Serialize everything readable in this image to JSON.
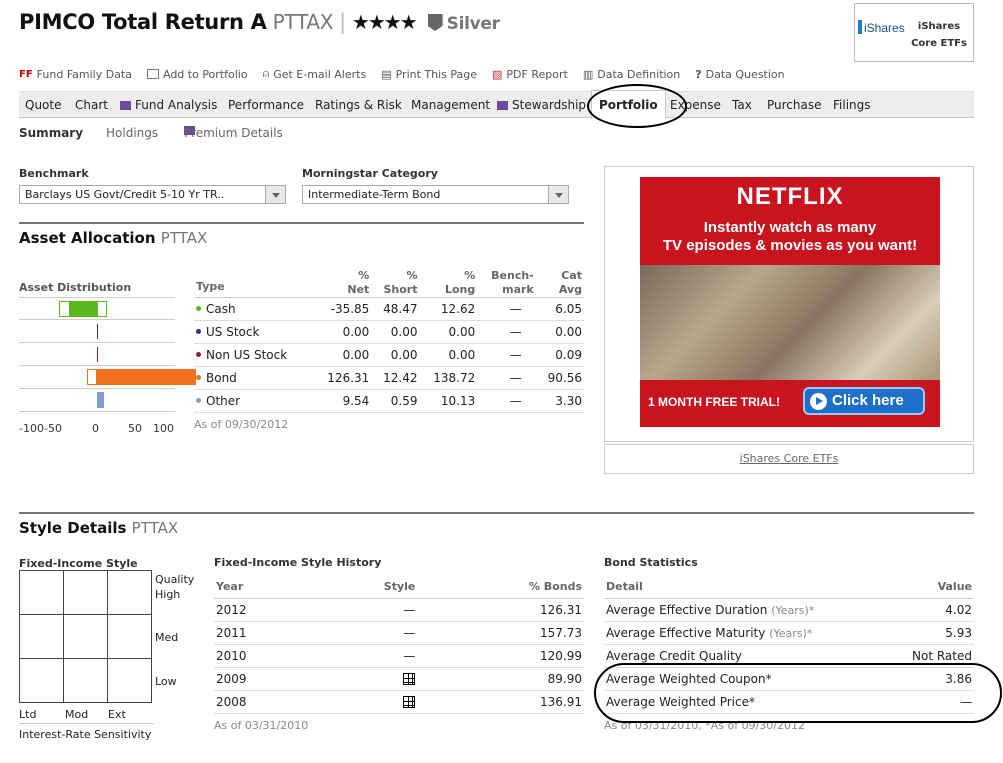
{
  "header": {
    "fund_name": "PIMCO Total Return A",
    "ticker": "PTTAX",
    "stars": "★★★★",
    "medal": "Silver",
    "sponsor_logo_text": "iShares",
    "sponsor_text": "iShares Core ETFs"
  },
  "toolbar": [
    {
      "icon": "ff-icon",
      "label": "Fund Family Data"
    },
    {
      "icon": "portfolio-icon",
      "label": "Add to Portfolio"
    },
    {
      "icon": "alert-icon",
      "label": "Get E-mail Alerts"
    },
    {
      "icon": "print-icon",
      "label": "Print This Page"
    },
    {
      "icon": "pdf-icon",
      "label": "PDF Report"
    },
    {
      "icon": "definition-icon",
      "label": "Data Definition"
    },
    {
      "icon": "question-icon",
      "label": "Data Question"
    }
  ],
  "tabs": [
    "Quote",
    "Chart",
    "Fund Analysis",
    "Performance",
    "Ratings & Risk",
    "Management",
    "Stewardship",
    "Portfolio",
    "Expense",
    "Tax",
    "Purchase",
    "Filings"
  ],
  "active_tab": "Portfolio",
  "subtabs": [
    "Summary",
    "Holdings",
    "Premium Details"
  ],
  "benchmark": {
    "label": "Benchmark",
    "value": "Barclays US Govt/Credit 5-10 Yr TR.."
  },
  "category": {
    "label": "Morningstar Category",
    "value": "Intermediate-Term Bond"
  },
  "asset_allocation": {
    "title": "Asset Allocation",
    "ticker": "PTTAX",
    "dist_label": "Asset Distribution",
    "headers": {
      "type": "Type",
      "net1": "%",
      "net2": "Net",
      "short1": "%",
      "short2": "Short",
      "long1": "%",
      "long2": "Long",
      "bench1": "Bench-",
      "bench2": "mark",
      "cat1": "Cat",
      "cat2": "Avg"
    },
    "rows": [
      {
        "type": "Cash",
        "color": "#5cb81f",
        "net": "-35.85",
        "short": "48.47",
        "long": "12.62",
        "bench": "—",
        "cat": "6.05",
        "net_value": -35.85,
        "short_value": 48.47
      },
      {
        "type": "US Stock",
        "color": "#1f3a7a",
        "net": "0.00",
        "short": "0.00",
        "long": "0.00",
        "bench": "—",
        "cat": "0.00",
        "net_value": 0,
        "short_value": 0
      },
      {
        "type": "Non US Stock",
        "color": "#a3162a",
        "net": "0.00",
        "short": "0.00",
        "long": "0.00",
        "bench": "—",
        "cat": "0.09",
        "net_value": 0,
        "short_value": 0
      },
      {
        "type": "Bond",
        "color": "#f07020",
        "net": "126.31",
        "short": "12.42",
        "long": "138.72",
        "bench": "—",
        "cat": "90.56",
        "net_value": 126.31,
        "short_value": 12.42
      },
      {
        "type": "Other",
        "color": "#7f9ec9",
        "net": "9.54",
        "short": "0.59",
        "long": "10.13",
        "bench": "—",
        "cat": "3.30",
        "net_value": 9.54,
        "short_value": 0.59
      }
    ],
    "axis_ticks": [
      "-100",
      "-50",
      "0",
      "50",
      "100"
    ],
    "as_of": "As of 09/30/2012"
  },
  "ad": {
    "brand": "NETFLIX",
    "line1": "Instantly watch as many",
    "line2": "TV episodes & movies as you want!",
    "trial": "1 MONTH FREE TRIAL!",
    "button": "Click here",
    "link": "iShares Core ETFs"
  },
  "style_details": {
    "title": "Style Details",
    "ticker": "PTTAX",
    "fi_style": {
      "label": "Fixed-Income Style",
      "quality": "Quality",
      "high": "High",
      "med": "Med",
      "low": "Low",
      "ltd": "Ltd",
      "mod": "Mod",
      "ext": "Ext",
      "sensitivity": "Interest-Rate Sensitivity"
    },
    "history": {
      "label": "Fixed-Income Style History",
      "headers": {
        "year": "Year",
        "style": "Style",
        "bonds": "% Bonds"
      },
      "rows": [
        {
          "year": "2012",
          "style": "—",
          "bonds": "126.31"
        },
        {
          "year": "2011",
          "style": "—",
          "bonds": "157.73"
        },
        {
          "year": "2010",
          "style": "—",
          "bonds": "120.99"
        },
        {
          "year": "2009",
          "style": "grid",
          "bonds": "89.90"
        },
        {
          "year": "2008",
          "style": "grid",
          "bonds": "136.91"
        }
      ],
      "as_of": "As of 03/31/2010"
    },
    "bond_stats": {
      "label": "Bond Statistics",
      "headers": {
        "detail": "Detail",
        "value": "Value"
      },
      "rows": [
        {
          "detail": "Average Effective Duration",
          "unit": "(Years)*",
          "value": "4.02"
        },
        {
          "detail": "Average Effective Maturity",
          "unit": "(Years)*",
          "value": "5.93"
        },
        {
          "detail": "Average Credit Quality",
          "unit": "",
          "value": "Not Rated"
        },
        {
          "detail": "Average Weighted Coupon*",
          "unit": "",
          "value": "3.86"
        },
        {
          "detail": "Average Weighted Price*",
          "unit": "",
          "value": "—"
        }
      ],
      "as_of": "As of 03/31/2010, *As of 09/30/2012"
    }
  }
}
